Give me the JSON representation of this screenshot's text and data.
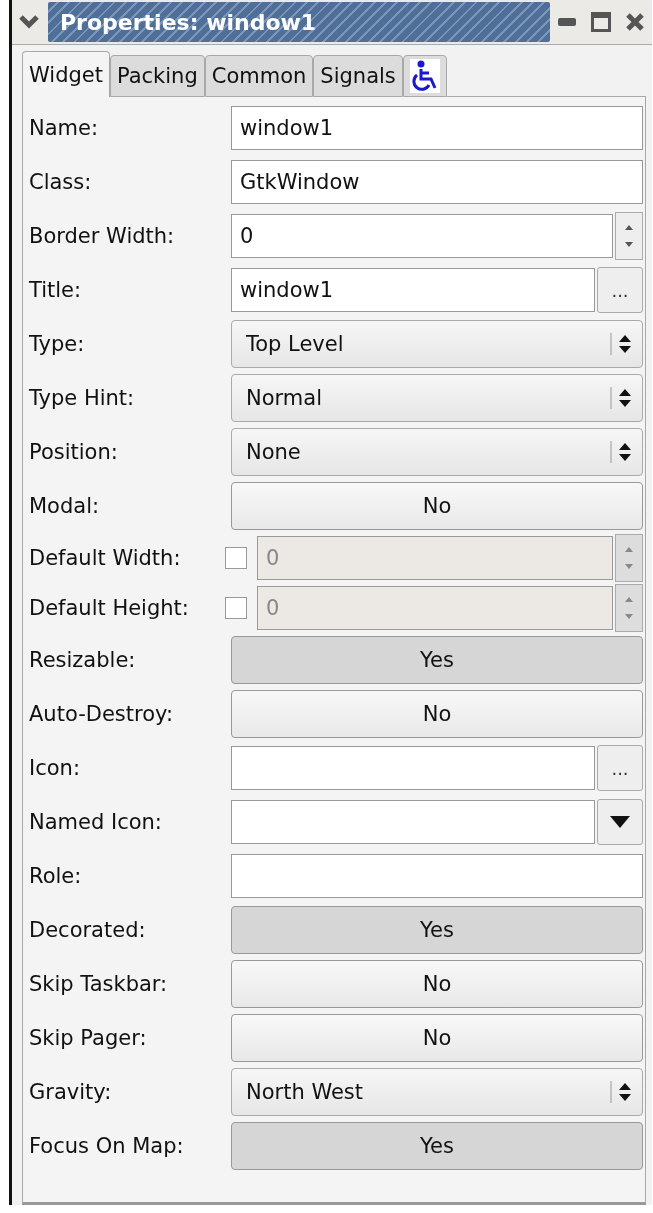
{
  "window": {
    "title": "Properties: window1"
  },
  "tabs": [
    {
      "label": "Widget",
      "selected": true,
      "kind": "text"
    },
    {
      "label": "Packing",
      "selected": false,
      "kind": "text"
    },
    {
      "label": "Common",
      "selected": false,
      "kind": "text"
    },
    {
      "label": "Signals",
      "selected": false,
      "kind": "text"
    },
    {
      "selected": false,
      "kind": "accessibility"
    }
  ],
  "properties": [
    {
      "label": "Name:",
      "kind": "entry",
      "value": "window1"
    },
    {
      "label": "Class:",
      "kind": "entry",
      "value": "GtkWindow"
    },
    {
      "label": "Border Width:",
      "kind": "spin",
      "value": "0"
    },
    {
      "label": "Title:",
      "kind": "entry_button",
      "value": "window1",
      "button": "..."
    },
    {
      "label": "Type:",
      "kind": "combo",
      "value": "Top Level"
    },
    {
      "label": "Type Hint:",
      "kind": "combo",
      "value": "Normal"
    },
    {
      "label": "Position:",
      "kind": "combo",
      "value": "None"
    },
    {
      "label": "Modal:",
      "kind": "toggle",
      "value": "No",
      "active": false
    },
    {
      "label": "Default Width:",
      "kind": "check_spin",
      "value": "0",
      "checked": false,
      "disabled": true
    },
    {
      "label": "Default Height:",
      "kind": "check_spin",
      "value": "0",
      "checked": false,
      "disabled": true
    },
    {
      "label": "Resizable:",
      "kind": "toggle",
      "value": "Yes",
      "active": true
    },
    {
      "label": "Auto-Destroy:",
      "kind": "toggle",
      "value": "No",
      "active": false
    },
    {
      "label": "Icon:",
      "kind": "entry_button",
      "button": "..."
    },
    {
      "label": "Named Icon:",
      "kind": "combo_entry"
    },
    {
      "label": "Role:",
      "kind": "entry"
    },
    {
      "label": "Decorated:",
      "kind": "toggle",
      "value": "Yes",
      "active": true
    },
    {
      "label": "Skip Taskbar:",
      "kind": "toggle",
      "value": "No",
      "active": false
    },
    {
      "label": "Skip Pager:",
      "kind": "toggle",
      "value": "No",
      "active": false
    },
    {
      "label": "Gravity:",
      "kind": "combo",
      "value": "North West"
    },
    {
      "label": "Focus On Map:",
      "kind": "toggle",
      "value": "Yes",
      "active": true
    }
  ]
}
